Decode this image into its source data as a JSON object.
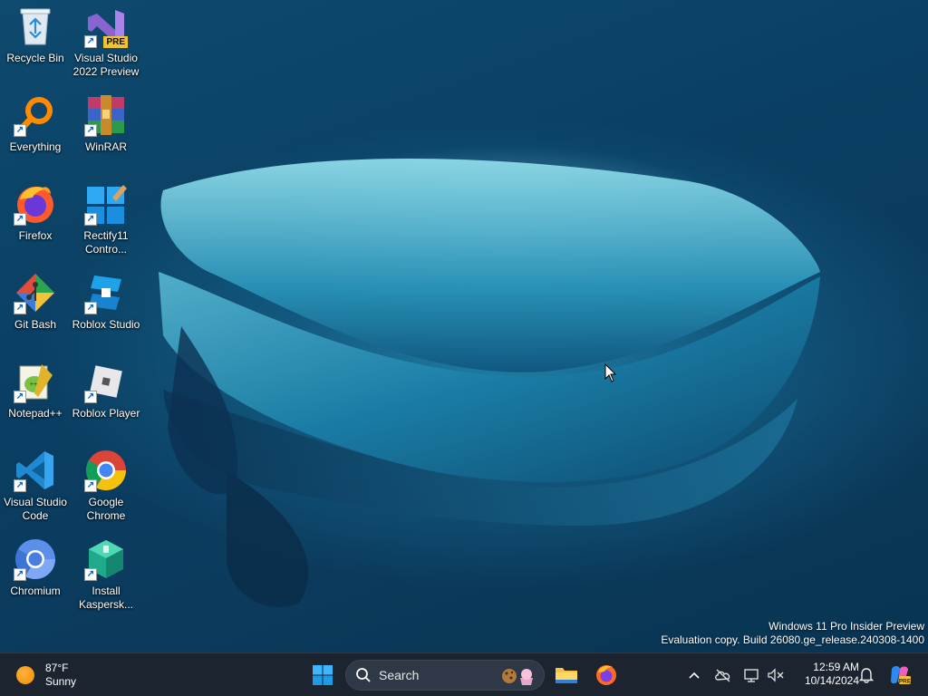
{
  "desktop": {
    "icons": [
      {
        "label": "Recycle Bin",
        "icon": "recycle-bin-icon"
      },
      {
        "label": "Visual Studio 2022 Preview",
        "icon": "visual-studio-preview-icon",
        "badge": "PRE"
      },
      {
        "label": "Everything",
        "icon": "everything-search-icon"
      },
      {
        "label": "WinRAR",
        "icon": "winrar-icon"
      },
      {
        "label": "Firefox",
        "icon": "firefox-icon"
      },
      {
        "label": "Rectify11 Contro...",
        "icon": "rectify11-icon"
      },
      {
        "label": "Git Bash",
        "icon": "git-bash-icon"
      },
      {
        "label": "Roblox Studio",
        "icon": "roblox-studio-icon"
      },
      {
        "label": "Notepad++",
        "icon": "notepad-plus-plus-icon"
      },
      {
        "label": "Roblox Player",
        "icon": "roblox-player-icon"
      },
      {
        "label": "Visual Studio Code",
        "icon": "vscode-icon"
      },
      {
        "label": "Google Chrome",
        "icon": "chrome-icon"
      },
      {
        "label": "Chromium",
        "icon": "chromium-icon"
      },
      {
        "label": "Install Kaspersk...",
        "icon": "kaspersky-install-icon"
      }
    ],
    "watermark": {
      "line1": "Windows 11 Pro Insider Preview",
      "line2": "Evaluation copy. Build 26080.ge_release.240308-1400"
    }
  },
  "taskbar": {
    "weather": {
      "temp": "87°F",
      "condition": "Sunny"
    },
    "search": {
      "placeholder": "Search"
    },
    "pinned": [
      "start-icon",
      "file-explorer-icon",
      "firefox-icon"
    ],
    "tray": [
      "chevron-up-icon",
      "onedrive-icon",
      "network-icon",
      "volume-muted-icon"
    ],
    "clock": {
      "time": "12:59 AM",
      "date": "10/14/2024"
    },
    "colors": {
      "taskbar": "#1c2430",
      "accent": "#0078d4"
    }
  }
}
